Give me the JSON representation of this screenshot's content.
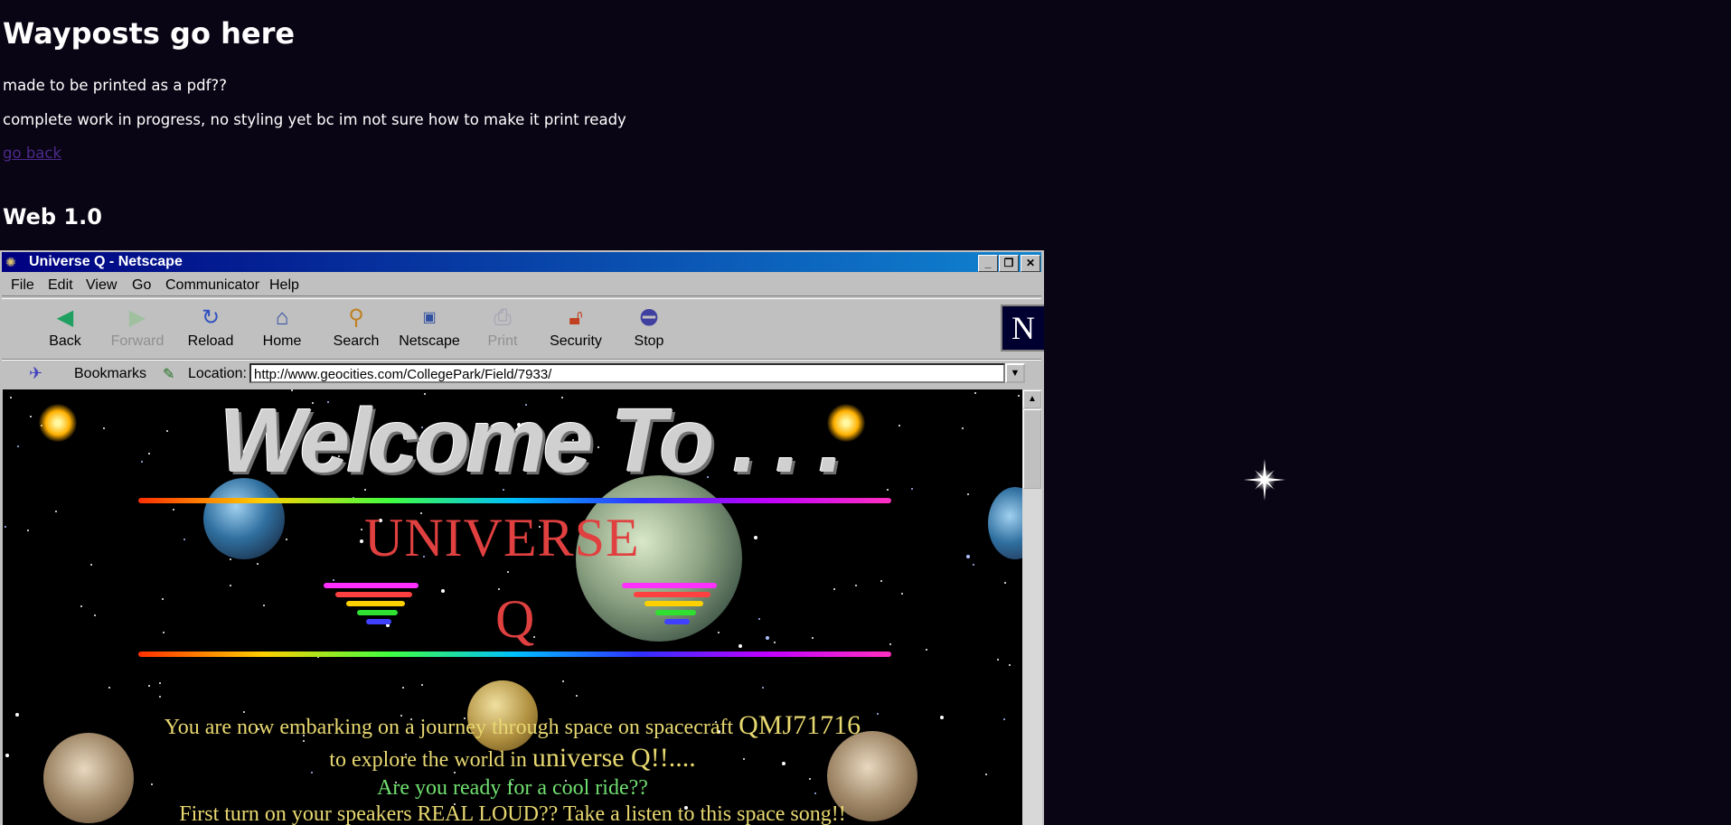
{
  "page": {
    "heading": "Wayposts go here",
    "line1": "made to be printed as a pdf??",
    "line2": "complete work in progress, no styling yet bc im not sure how to make it print ready",
    "back_link": "go back",
    "section_heading": "Web 1.0"
  },
  "browser": {
    "title": "Universe Q - Netscape",
    "menu": [
      "File",
      "Edit",
      "View",
      "Go",
      "Communicator",
      "Help"
    ],
    "toolbar": [
      {
        "label": "Back",
        "icon": "back-arrow-icon",
        "enabled": true
      },
      {
        "label": "Forward",
        "icon": "forward-arrow-icon",
        "enabled": false
      },
      {
        "label": "Reload",
        "icon": "reload-icon",
        "enabled": true
      },
      {
        "label": "Home",
        "icon": "home-icon",
        "enabled": true
      },
      {
        "label": "Search",
        "icon": "search-icon",
        "enabled": true
      },
      {
        "label": "Netscape",
        "icon": "netscape-icon",
        "enabled": true
      },
      {
        "label": "Print",
        "icon": "print-icon",
        "enabled": false
      },
      {
        "label": "Security",
        "icon": "lock-icon",
        "enabled": true
      },
      {
        "label": "Stop",
        "icon": "stop-icon",
        "enabled": true
      }
    ],
    "bookmarks_label": "Bookmarks",
    "location_label": "Location:",
    "url": "http://www.geocities.com/CollegePark/Field/7933/",
    "logo_letter": "N"
  },
  "site": {
    "welcome": "Welcome To . . .",
    "universe": "UNIVERSE",
    "q": "Q",
    "msg1a": "You are now embarking on a journey through space on spacecraft ",
    "msg1b": "QMJ71716",
    "msg2a": "to explore the world in ",
    "msg2b": "universe Q!!....",
    "msg3": "Are you ready for a cool ride??",
    "msg4": "First turn on your speakers REAL LOUD?? Take a listen to this space song!!"
  },
  "colors": {
    "page_bg": "#0a0514",
    "link": "#4a2a8a",
    "titlebar": "#000080",
    "universe_red": "#e04040",
    "message_yellow": "#e8d870",
    "message_green": "#70e070"
  }
}
